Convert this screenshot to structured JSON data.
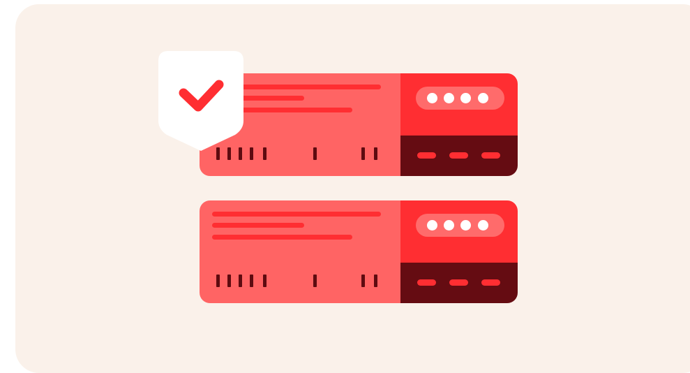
{
  "colors": {
    "background": "#FAF1EA",
    "card_body": "#FF6464",
    "card_lines": "#FF2E32",
    "card_ticks": "#5E0B10",
    "pin_panel": "#FF2E32",
    "pin_pill": "#FF6B6B",
    "pin_dots": "#FFFFFF",
    "bottom_panel": "#650C12",
    "dashes": "#FF2E32",
    "shield": "#FFFFFF",
    "checkmark": "#FF2E32"
  },
  "icons": {
    "shield": "shield-check-icon",
    "masked_pin": "masked-pin-icon"
  },
  "cards": [
    {
      "name": "server-card-top",
      "verified": true,
      "pin_dots": 4,
      "dashes": 3
    },
    {
      "name": "server-card-bottom",
      "verified": false,
      "pin_dots": 4,
      "dashes": 3
    }
  ]
}
